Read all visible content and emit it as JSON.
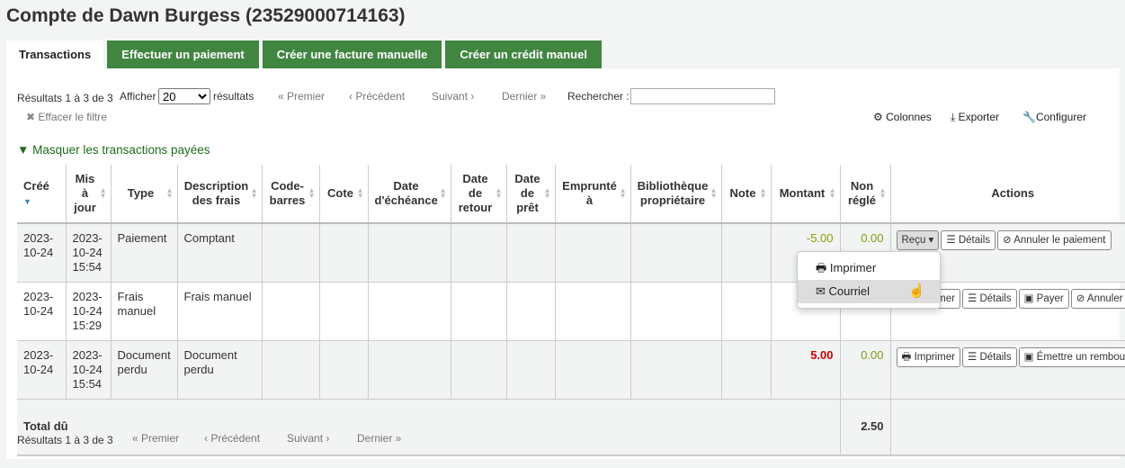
{
  "title": "Compte de Dawn Burgess (23529000714163)",
  "tabs": [
    "Transactions",
    "Effectuer un paiement",
    "Créer une facture manuelle",
    "Créer un crédit manuel"
  ],
  "toolbar": {
    "results_info": "Résultats 1 à 3 de 3",
    "show_label": "Afficher",
    "show_value": "20",
    "results_label": "résultats",
    "first": "« Premier",
    "prev": "‹ Précédent",
    "next": "Suivant ›",
    "last": "Dernier »",
    "search_label": "Rechercher :",
    "search_value": "",
    "clear_filter": "Effacer le filtre",
    "columns": "Colonnes",
    "export": "Exporter",
    "configure": "Configurer",
    "hide_paid": "Masquer les transactions payées"
  },
  "columns": [
    "Créé",
    "Mis à jour",
    "Type",
    "Description des frais",
    "Code-barres",
    "Cote",
    "Date d'échéance",
    "Date de retour",
    "Date de prêt",
    "Emprunté à",
    "Bibliothèque propriétaire",
    "Note",
    "Montant",
    "Non réglé",
    "Actions"
  ],
  "rows": [
    {
      "created": "2023-10-24",
      "updated": "2023-10-24 15:54",
      "type": "Paiement",
      "description": "Comptant",
      "amount": "-5.00",
      "outstanding": "0.00",
      "actions": [
        "Reçu",
        "Détails",
        "Annuler le paiement"
      ]
    },
    {
      "created": "2023-10-24",
      "updated": "2023-10-24 15:29",
      "type": "Frais manuel",
      "description": "Frais manuel",
      "amount": "",
      "outstanding": "",
      "actions": [
        "Imprimer",
        "Détails",
        "Payer",
        "Annuler le paiement"
      ]
    },
    {
      "created": "2023-10-24",
      "updated": "2023-10-24 15:54",
      "type": "Document perdu",
      "description": "Document perdu",
      "amount": "5.00",
      "outstanding": "0.00",
      "actions": [
        "Imprimer",
        "Détails",
        "Émettre un remboursement"
      ]
    }
  ],
  "total": {
    "label": "Total dû",
    "value": "2.50"
  },
  "footer": {
    "results_info": "Résultats 1 à 3 de 3",
    "first": "« Premier",
    "prev": "‹ Précédent",
    "next": "Suivant ›",
    "last": "Dernier »"
  },
  "dropdown": {
    "items": [
      "Imprimer",
      "Courriel"
    ]
  },
  "colors": {
    "tab_green": "#408540",
    "negative": "#8a9a00",
    "positive": "#cc0000"
  }
}
